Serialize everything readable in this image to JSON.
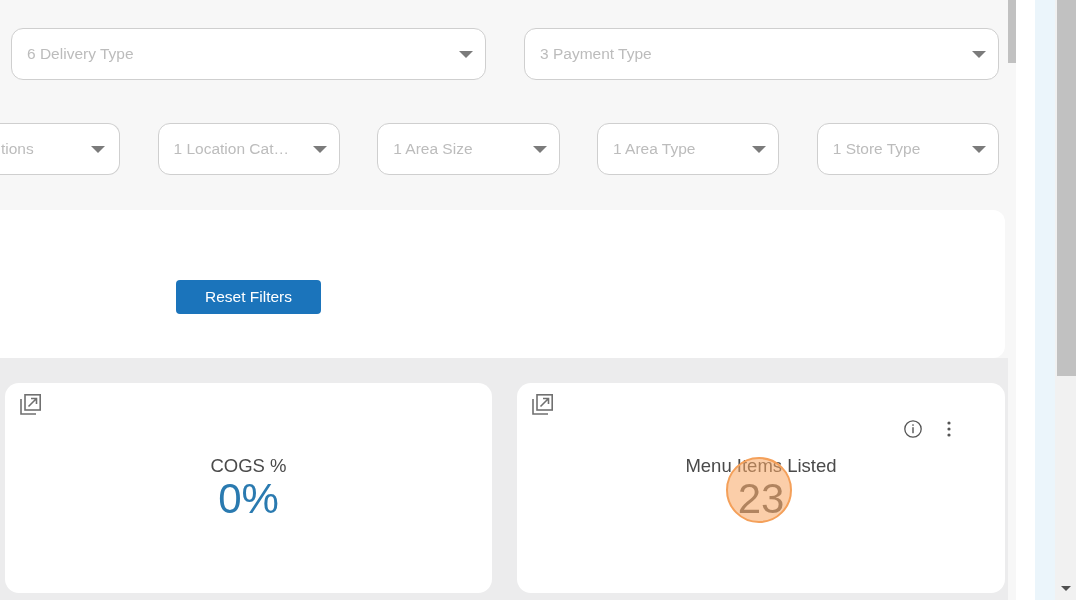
{
  "filter_rows": [
    {
      "filters": [
        {
          "label": "6 Delivery Type"
        },
        {
          "label": "3 Payment Type"
        }
      ]
    },
    {
      "filters": [
        {
          "label": "tions"
        },
        {
          "label": "1 Location Cat…"
        },
        {
          "label": "1 Area Size"
        },
        {
          "label": "1 Area Type"
        },
        {
          "label": "1 Store Type"
        }
      ]
    }
  ],
  "reset_button": {
    "label": "Reset Filters"
  },
  "cards": [
    {
      "title": "COGS %",
      "value": "0%",
      "accent": true,
      "has_actions": false
    },
    {
      "title": "Menu Items Listed",
      "value": "23",
      "accent": false,
      "has_actions": true
    }
  ]
}
